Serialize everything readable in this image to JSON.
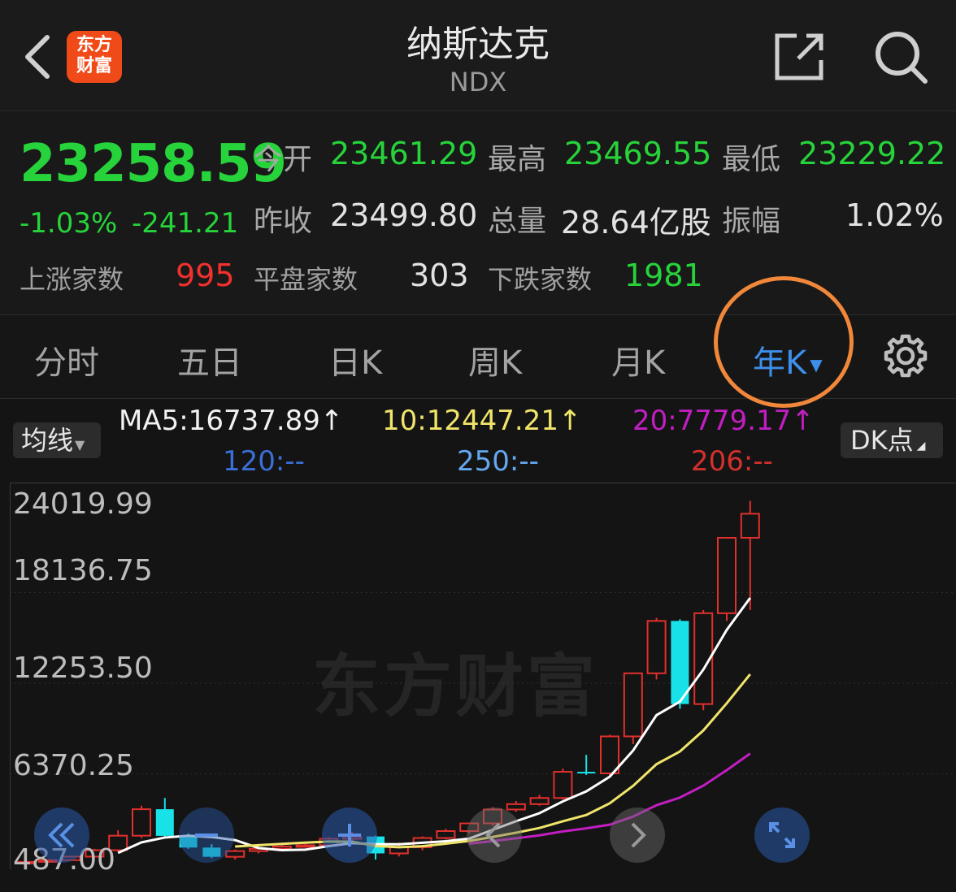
{
  "header": {
    "title": "纳斯达克",
    "subtitle": "NDX",
    "logo_line1": "东方",
    "logo_line2": "财富"
  },
  "quote": {
    "price": "23258.59",
    "change_pct": "-1.03%",
    "change_abs": "-241.21",
    "open_label": "今开",
    "open": "23461.29",
    "high_label": "最高",
    "high": "23469.55",
    "low_label": "最低",
    "low": "23229.22",
    "prev_close_label": "昨收",
    "prev_close": "23499.80",
    "volume_label": "总量",
    "volume": "28.64亿股",
    "amplitude_label": "振幅",
    "amplitude": "1.02%",
    "up_label": "上涨家数",
    "up": "995",
    "flat_label": "平盘家数",
    "flat": "303",
    "down_label": "下跌家数",
    "down": "1981"
  },
  "tabs": {
    "items": [
      "分时",
      "五日",
      "日K",
      "周K",
      "月K"
    ],
    "active": "年K"
  },
  "indicators": {
    "ma_button": "均线",
    "ma5": "MA5:16737.89↑",
    "ma10": "10:12447.21↑",
    "ma20": "20:7779.17↑",
    "ma120": "120:--",
    "ma250": "250:--",
    "ma206": "206:--",
    "dk_button": "DK点"
  },
  "chart_data": {
    "type": "candlestick",
    "y_tick_labels": [
      "24019.99",
      "18136.75",
      "12253.50",
      "6370.25",
      "487.00"
    ],
    "ylim": [
      487.0,
      24019.99
    ],
    "watermark": "东方财富",
    "colors": {
      "up": "#e0302c",
      "down": "#18e2e8",
      "ma5": "#ffffff",
      "ma10": "#f0e56a",
      "ma20": "#c21ec2"
    },
    "candles": [
      {
        "o": 600,
        "c": 650,
        "h": 680,
        "l": 560
      },
      {
        "o": 650,
        "c": 760,
        "h": 800,
        "l": 620
      },
      {
        "o": 760,
        "c": 990,
        "h": 1050,
        "l": 720
      },
      {
        "o": 990,
        "c": 1410,
        "h": 1500,
        "l": 950
      },
      {
        "o": 1410,
        "c": 2350,
        "h": 2700,
        "l": 1300
      },
      {
        "o": 2350,
        "c": 4070,
        "h": 4300,
        "l": 2200
      },
      {
        "o": 4070,
        "c": 2340,
        "h": 4800,
        "l": 2200
      },
      {
        "o": 2340,
        "c": 1580,
        "h": 2500,
        "l": 1500
      },
      {
        "o": 1580,
        "c": 980,
        "h": 1800,
        "l": 900
      },
      {
        "o": 980,
        "c": 1350,
        "h": 1450,
        "l": 800
      },
      {
        "o": 1350,
        "c": 1500,
        "h": 1600,
        "l": 1200
      },
      {
        "o": 1500,
        "c": 1650,
        "h": 1800,
        "l": 1400
      },
      {
        "o": 1650,
        "c": 1730,
        "h": 1850,
        "l": 1600
      },
      {
        "o": 1730,
        "c": 2150,
        "h": 2250,
        "l": 1700
      },
      {
        "o": 2150,
        "c": 2300,
        "h": 2600,
        "l": 2000
      },
      {
        "o": 2300,
        "c": 1200,
        "h": 2350,
        "l": 800
      },
      {
        "o": 1200,
        "c": 1600,
        "h": 1900,
        "l": 1000
      },
      {
        "o": 1600,
        "c": 2200,
        "h": 2300,
        "l": 1400
      },
      {
        "o": 2200,
        "c": 2650,
        "h": 2800,
        "l": 2100
      },
      {
        "o": 2650,
        "c": 3150,
        "h": 3200,
        "l": 2500
      },
      {
        "o": 3150,
        "c": 4050,
        "h": 4200,
        "l": 3000
      },
      {
        "o": 4050,
        "c": 4400,
        "h": 4600,
        "l": 3900
      },
      {
        "o": 4400,
        "c": 4800,
        "h": 5000,
        "l": 4300
      },
      {
        "o": 4800,
        "c": 6500,
        "h": 6700,
        "l": 4700
      },
      {
        "o": 6500,
        "c": 6400,
        "h": 7600,
        "l": 6300
      },
      {
        "o": 6400,
        "c": 8800,
        "h": 8900,
        "l": 6200
      },
      {
        "o": 8800,
        "c": 12900,
        "h": 12950,
        "l": 8300
      },
      {
        "o": 12900,
        "c": 16300,
        "h": 16500,
        "l": 12500
      },
      {
        "o": 16300,
        "c": 10900,
        "h": 16400,
        "l": 10600
      },
      {
        "o": 10900,
        "c": 16800,
        "h": 17000,
        "l": 10500
      },
      {
        "o": 16800,
        "c": 21700,
        "h": 19500,
        "l": 16300
      },
      {
        "o": 21700,
        "c": 23259,
        "h": 24100,
        "l": 17000
      }
    ]
  }
}
